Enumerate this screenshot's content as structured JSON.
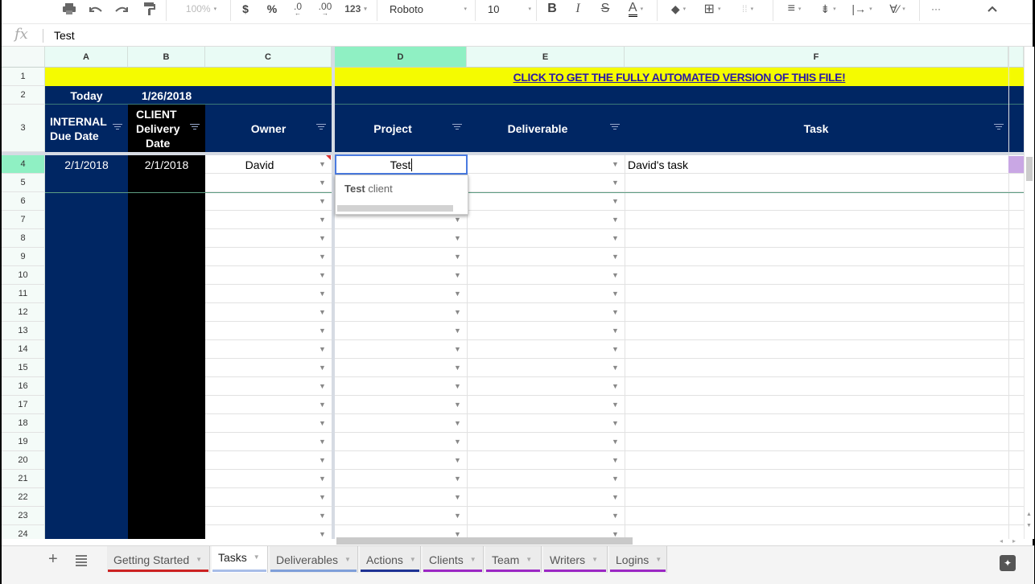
{
  "toolbar": {
    "zoom": "100%",
    "currency": "$",
    "percent": "%",
    "dec_decrease": ".0",
    "dec_increase": ".00",
    "more_formats": "123",
    "font": "Roboto",
    "font_size": "10",
    "bold": "B",
    "italic": "I",
    "strike": "S",
    "text_color": "A",
    "more": "···",
    "collapse": "^"
  },
  "formula_bar": {
    "fx": "fx",
    "value": "Test"
  },
  "columns": [
    "A",
    "B",
    "C",
    "D",
    "E",
    "F"
  ],
  "banner": "CLICK TO GET THE FULLY AUTOMATED VERSION OF THIS FILE!",
  "row2": {
    "label": "Today",
    "date": "1/26/2018"
  },
  "headers": {
    "a": [
      "INTERNAL",
      "Due Date"
    ],
    "b": [
      "CLIENT",
      "Delivery",
      "Date"
    ],
    "c": "Owner",
    "d": "Project",
    "e": "Deliverable",
    "f": "Task"
  },
  "row_numbers": [
    "1",
    "2",
    "3",
    "4",
    "5",
    "6",
    "7",
    "8",
    "9",
    "10",
    "11",
    "12",
    "13",
    "14",
    "15",
    "16",
    "17",
    "18",
    "19",
    "20",
    "21",
    "22",
    "23",
    "24"
  ],
  "row4": {
    "internal_due": "2/1/2018",
    "client_delivery": "2/1/2018",
    "owner": "David",
    "project_editing": "Test",
    "task": "David's task"
  },
  "autocomplete": {
    "match": "Test",
    "rest": " client"
  },
  "sheet_tabs": [
    {
      "label": "Getting Started",
      "color": "#cc2222",
      "active": false
    },
    {
      "label": "Tasks",
      "color": "#a8bde8",
      "active": true
    },
    {
      "label": "Deliverables",
      "color": "#7f9fd9",
      "active": false
    },
    {
      "label": "Actions",
      "color": "#1f3394",
      "active": false
    },
    {
      "label": "Clients",
      "color": "#9b27c4",
      "active": false
    },
    {
      "label": "Team",
      "color": "#9b27c4",
      "active": false
    },
    {
      "label": "Writers",
      "color": "#9b27c4",
      "active": false
    },
    {
      "label": "Logins",
      "color": "#9b27c4",
      "active": false
    }
  ],
  "colors": {
    "navy": "#002663",
    "black": "#000000",
    "yellow": "#f5fb00",
    "banner_text": "#2b1aa5",
    "selected_header": "#8ff0c3",
    "purple_cell": "#c9a7e4"
  }
}
